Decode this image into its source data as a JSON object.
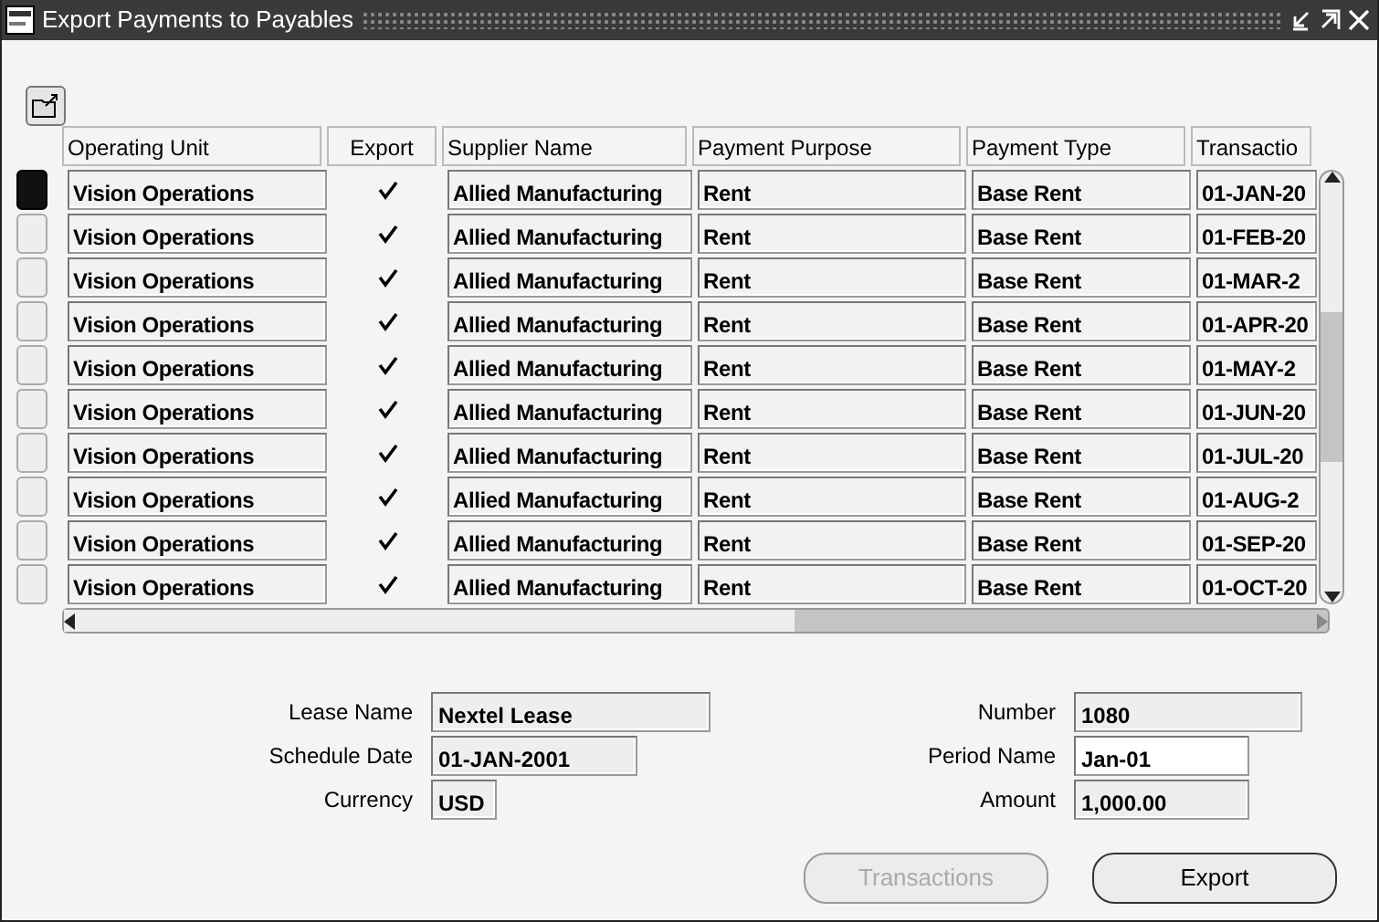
{
  "window": {
    "title": "Export Payments to Payables"
  },
  "table": {
    "columns": [
      "Operating Unit",
      "Export",
      "Supplier Name",
      "Payment Purpose",
      "Payment Type",
      "Transactio"
    ],
    "rows": [
      {
        "selected": true,
        "operating_unit": "Vision Operations",
        "export": true,
        "supplier_name": "Allied Manufacturing",
        "payment_purpose": "Rent",
        "payment_type": "Base Rent",
        "transaction": "01-JAN-20"
      },
      {
        "selected": false,
        "operating_unit": "Vision Operations",
        "export": true,
        "supplier_name": "Allied Manufacturing",
        "payment_purpose": "Rent",
        "payment_type": "Base Rent",
        "transaction": "01-FEB-20"
      },
      {
        "selected": false,
        "operating_unit": "Vision Operations",
        "export": true,
        "supplier_name": "Allied Manufacturing",
        "payment_purpose": "Rent",
        "payment_type": "Base Rent",
        "transaction": "01-MAR-2"
      },
      {
        "selected": false,
        "operating_unit": "Vision Operations",
        "export": true,
        "supplier_name": "Allied Manufacturing",
        "payment_purpose": "Rent",
        "payment_type": "Base Rent",
        "transaction": "01-APR-20"
      },
      {
        "selected": false,
        "operating_unit": "Vision Operations",
        "export": true,
        "supplier_name": "Allied Manufacturing",
        "payment_purpose": "Rent",
        "payment_type": "Base Rent",
        "transaction": "01-MAY-2"
      },
      {
        "selected": false,
        "operating_unit": "Vision Operations",
        "export": true,
        "supplier_name": "Allied Manufacturing",
        "payment_purpose": "Rent",
        "payment_type": "Base Rent",
        "transaction": "01-JUN-20"
      },
      {
        "selected": false,
        "operating_unit": "Vision Operations",
        "export": true,
        "supplier_name": "Allied Manufacturing",
        "payment_purpose": "Rent",
        "payment_type": "Base Rent",
        "transaction": "01-JUL-20"
      },
      {
        "selected": false,
        "operating_unit": "Vision Operations",
        "export": true,
        "supplier_name": "Allied Manufacturing",
        "payment_purpose": "Rent",
        "payment_type": "Base Rent",
        "transaction": "01-AUG-2"
      },
      {
        "selected": false,
        "operating_unit": "Vision Operations",
        "export": true,
        "supplier_name": "Allied Manufacturing",
        "payment_purpose": "Rent",
        "payment_type": "Base Rent",
        "transaction": "01-SEP-20"
      },
      {
        "selected": false,
        "operating_unit": "Vision Operations",
        "export": true,
        "supplier_name": "Allied Manufacturing",
        "payment_purpose": "Rent",
        "payment_type": "Base Rent",
        "transaction": "01-OCT-20"
      }
    ]
  },
  "details": {
    "left": [
      {
        "label": "Lease Name",
        "value": "Nextel Lease",
        "editable": false
      },
      {
        "label": "Schedule Date",
        "value": "01-JAN-2001",
        "editable": false
      },
      {
        "label": "Currency",
        "value": "USD",
        "editable": false
      }
    ],
    "right": [
      {
        "label": "Number",
        "value": "1080",
        "editable": false
      },
      {
        "label": "Period Name",
        "value": "Jan-01",
        "editable": true
      },
      {
        "label": "Amount",
        "value": "1,000.00",
        "editable": false
      }
    ]
  },
  "buttons": [
    {
      "label": "Transactions",
      "disabled": true
    },
    {
      "label": "Export",
      "disabled": false
    }
  ]
}
